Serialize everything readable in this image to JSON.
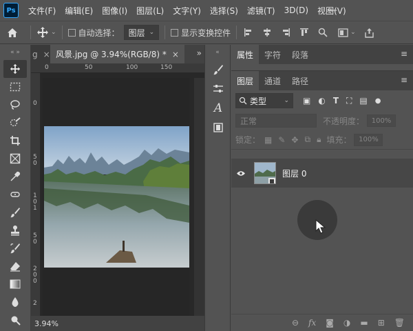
{
  "app": {
    "logo": "Ps"
  },
  "menu": [
    "文件(F)",
    "编辑(E)",
    "图像(I)",
    "图层(L)",
    "文字(Y)",
    "选择(S)",
    "滤镜(T)",
    "3D(D)",
    "视图(V)"
  ],
  "window_controls": {
    "minimize": "—"
  },
  "options": {
    "home_icon": "home-icon",
    "auto_select_label": "自动选择：",
    "auto_select_value": "图层",
    "show_transform_label": "显示变换控件"
  },
  "document": {
    "partial_tab": "g",
    "tab_title": "风景.jpg @ 3.94%(RGB/8) *",
    "tab_close": "×",
    "tabs_overflow": "»",
    "ruler_top": [
      "0",
      "50",
      "100",
      "150"
    ],
    "ruler_left": [
      "0",
      "5",
      "0",
      "1",
      "0",
      "1",
      "5",
      "0",
      "2",
      "0",
      "0",
      "2",
      "5",
      "0"
    ],
    "zoom": "3.94%"
  },
  "panels": {
    "top_tabs": [
      "属性",
      "字符",
      "段落"
    ],
    "layer_tabs": [
      "图层",
      "通道",
      "路径"
    ],
    "filter_kind": "类型",
    "blend_mode": "正常",
    "opacity_label": "不透明度：",
    "opacity_value": "100%",
    "lock_label": "锁定：",
    "fill_label": "填充：",
    "fill_value": "100%",
    "layer": {
      "name": "图层 0"
    }
  },
  "colors": {
    "ui_bg": "#535353",
    "canvas_bg": "#2b2b2b",
    "accent": "#31a8ff"
  }
}
